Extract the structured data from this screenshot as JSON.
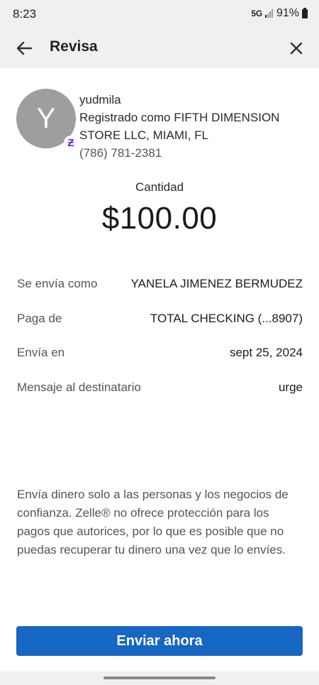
{
  "status": {
    "time": "8:23",
    "network": "5G",
    "battery": "91%"
  },
  "header": {
    "title": "Revisa"
  },
  "recipient": {
    "avatar_letter": "Y",
    "name": "yudmila",
    "registered_line1": "Registrado como FIFTH DIMENSION",
    "registered_line2": "STORE LLC, MIAMI, FL",
    "phone": "(786) 781-2381",
    "badge_glyph": "Ƶ"
  },
  "amount": {
    "label": "Cantidad",
    "value": "$100.00"
  },
  "details": [
    {
      "label": "Se envía como",
      "value": "YANELA JIMENEZ BERMUDEZ"
    },
    {
      "label": "Paga de",
      "value": "TOTAL CHECKING (...8907)"
    },
    {
      "label": "Envía en",
      "value": "sept 25, 2024"
    },
    {
      "label": "Mensaje al destinatario",
      "value": "urge"
    }
  ],
  "disclaimer": "Envía dinero solo a las personas y los negocios de confianza. Zelle® no ofrece protección para los pagos que autorices, por lo que es posible que no puedas recuperar tu dinero una vez que lo envíes.",
  "actions": {
    "send_label": "Enviar ahora"
  },
  "colors": {
    "primary": "#1666c4",
    "zelle": "#6d1ed4",
    "avatar": "#9e9e9e"
  },
  "icons": {
    "back": "arrow-left-icon",
    "close": "close-icon"
  }
}
